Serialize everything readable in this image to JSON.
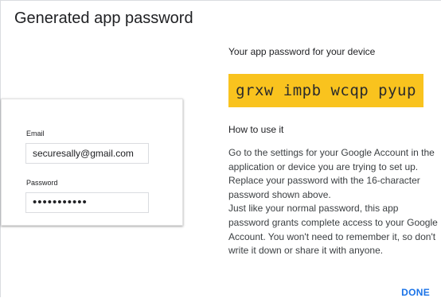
{
  "dialog": {
    "title": "Generated app password"
  },
  "device_card": {
    "email_label": "Email",
    "email_value": "securesally@gmail.com",
    "password_label": "Password",
    "password_value": "•••••••••••"
  },
  "password_panel": {
    "heading": "Your app password for your device",
    "password": "grxw impb wcqp pyup",
    "highlight_color": "#f9c31e"
  },
  "instructions": {
    "heading": "How to use it",
    "paragraph_1": "Go to the settings for your Google Account in the application or device you are trying to set up. Replace your password with the 16-character password shown above.",
    "paragraph_2": "Just like your normal password, this app password grants complete access to your Google Account. You won't need to remember it, so don't write it down or share it with anyone."
  },
  "actions": {
    "done_label": "DONE",
    "accent_color": "#1a73e8"
  }
}
